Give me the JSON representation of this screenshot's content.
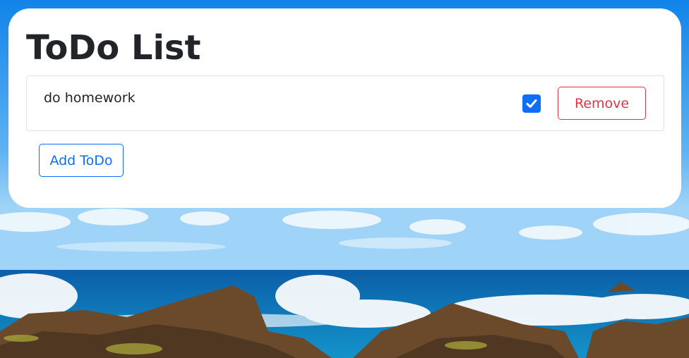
{
  "page": {
    "title": "ToDo List"
  },
  "todos": [
    {
      "text": "do homework",
      "completed": true,
      "remove_label": "Remove"
    }
  ],
  "actions": {
    "add_label": "Add ToDo"
  },
  "colors": {
    "primary": "#0d6efd",
    "danger": "#dc3545",
    "text": "#212529",
    "card_bg": "#ffffff"
  },
  "icons": {
    "checkbox": "check-icon",
    "background": "ocean-rocks-photo"
  }
}
